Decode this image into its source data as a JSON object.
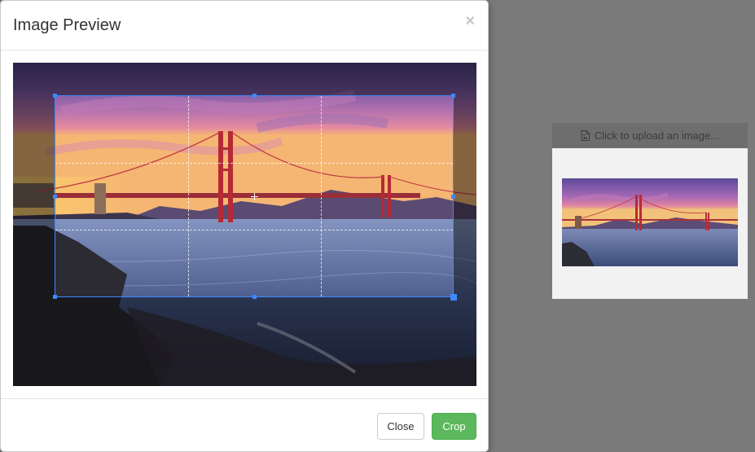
{
  "modal": {
    "title": "Image Preview",
    "close_x": "×",
    "footer": {
      "close_label": "Close",
      "crop_label": "Crop"
    }
  },
  "upload": {
    "button_label": "Click to upload an image...",
    "icon": "file-image-icon"
  },
  "colors": {
    "accent_blue": "#3d8aff",
    "crop_green": "#5cb85c",
    "overlay_gray": "#7a7a7a"
  }
}
